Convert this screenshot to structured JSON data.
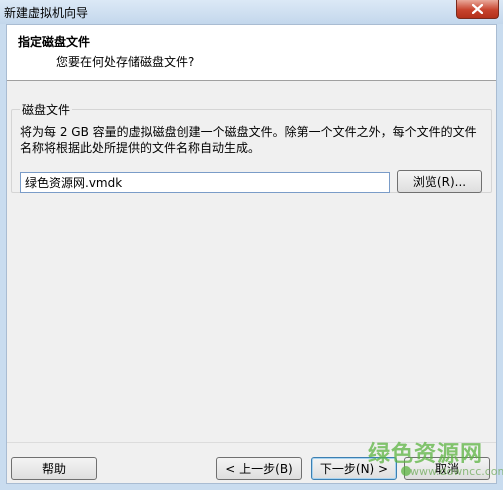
{
  "window": {
    "title": "新建虚拟机向导",
    "close_glyph": "✕"
  },
  "header": {
    "title": "指定磁盘文件",
    "subtitle": "您要在何处存储磁盘文件?"
  },
  "disk_group": {
    "legend": "磁盘文件",
    "description": "将为每 2 GB 容量的虚拟磁盘创建一个磁盘文件。除第一个文件之外，每个文件的文件名称将根据此处所提供的文件名称自动生成。",
    "file_value": "绿色资源网.vmdk",
    "browse_label": "浏览(R)..."
  },
  "footer": {
    "help_label": "帮助",
    "back_label": "< 上一步(B)",
    "next_label": "下一步(N) >",
    "cancel_label": "取消"
  },
  "watermark": {
    "text_cn": "绿色资源网",
    "text_en": "www.downcc.com"
  },
  "colors": {
    "close_button": "#c7432d",
    "frame": "#c9dcef",
    "watermark": "#5cb441"
  }
}
